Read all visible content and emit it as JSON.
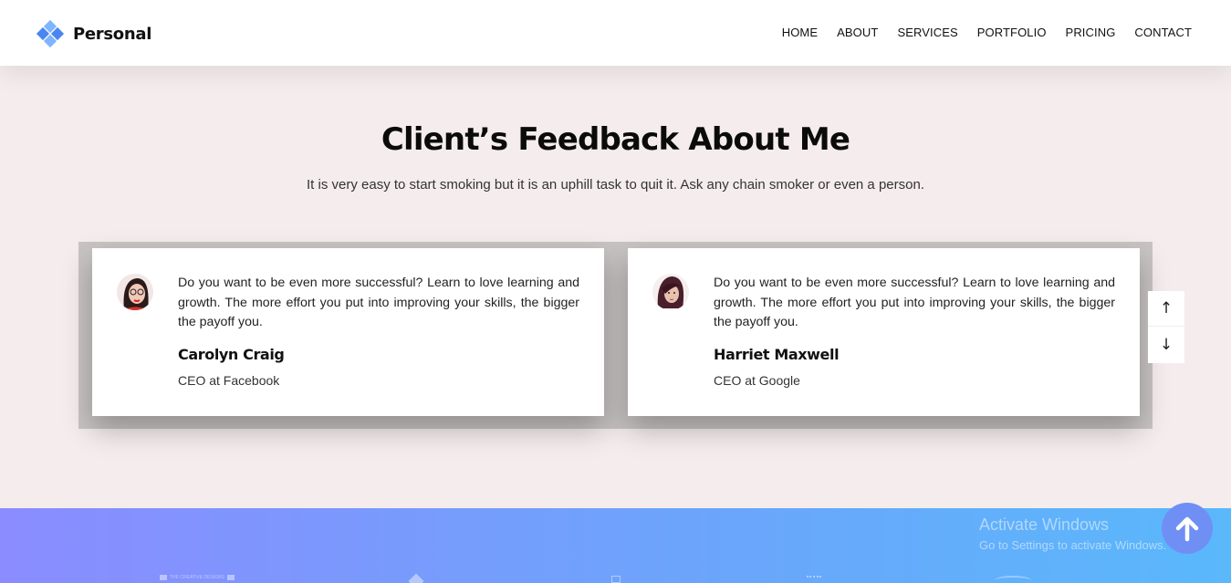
{
  "brand": {
    "name": "Personal",
    "colors": {
      "diamond_light": "#7fb4ff",
      "diamond_dark": "#4a86f0"
    }
  },
  "nav": {
    "items": [
      {
        "label": "HOME"
      },
      {
        "label": "ABOUT"
      },
      {
        "label": "SERVICES"
      },
      {
        "label": "PORTFOLIO"
      },
      {
        "label": "PRICING"
      },
      {
        "label": "CONTACT"
      }
    ]
  },
  "feedback": {
    "title": "Client’s Feedback About Me",
    "subtitle": "It is very easy to start smoking but it is an uphill task to quit it. Ask any chain smoker or even a person.",
    "testimonials": [
      {
        "quote": "Do you want to be even more successful? Learn to love learning and growth. The more effort you put into improving your skills, the bigger the payoff you.",
        "name": "Carolyn Craig",
        "role": "CEO at Facebook",
        "avatar_icon": "avatar-woman-glasses"
      },
      {
        "quote": "Do you want to be even more successful? Learn to love learning and growth. The more effort you put into improving your skills, the bigger the payoff you.",
        "name": "Harriet Maxwell",
        "role": "CEO at Google",
        "avatar_icon": "avatar-woman-dark-hair"
      }
    ],
    "controls": {
      "up_symbol": "↑",
      "down_symbol": "↓"
    }
  },
  "footer": {
    "brand_logo_text": "THE CREATIVE DESIGNS",
    "watermark": {
      "line1": "Activate Windows",
      "line2": "Go to Settings to activate Windows."
    },
    "gradient": {
      "start": "#8a8cff",
      "end": "#5ab8fb"
    }
  },
  "scroll_top": {
    "icon": "arrow-up-icon",
    "color": "#6f8ff5"
  }
}
